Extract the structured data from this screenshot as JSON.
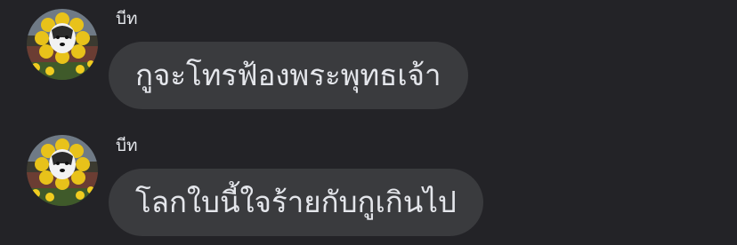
{
  "messages": [
    {
      "sender": "บีท",
      "text": "กูจะโทรฟ้องพระพุทธเจ้า",
      "avatar_icon": "dog-in-sunflower-costume-avatar"
    },
    {
      "sender": "บีท",
      "text": "โลกใบนี้ใจร้ายกับกูเกินไป",
      "avatar_icon": "dog-in-sunflower-costume-avatar"
    }
  ],
  "colors": {
    "background": "#232327",
    "bubble": "#3a3b3e",
    "text": "#e4e6eb"
  }
}
